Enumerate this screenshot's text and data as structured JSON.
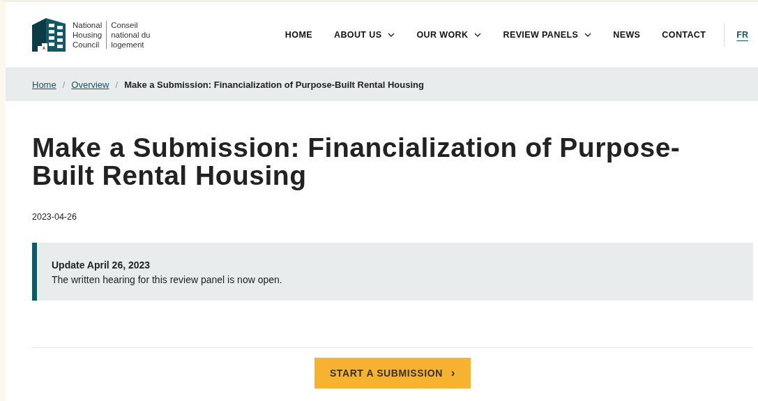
{
  "logo": {
    "english": [
      "National",
      "Housing",
      "Council"
    ],
    "french": [
      "Conseil",
      "national du",
      "logement"
    ]
  },
  "nav": [
    {
      "label": "HOME",
      "dropdown": false
    },
    {
      "label": "ABOUT US",
      "dropdown": true
    },
    {
      "label": "OUR WORK",
      "dropdown": true
    },
    {
      "label": "REVIEW PANELS",
      "dropdown": true
    },
    {
      "label": "NEWS",
      "dropdown": false
    },
    {
      "label": "CONTACT",
      "dropdown": false
    }
  ],
  "language": "FR",
  "breadcrumb": {
    "links": [
      "Home",
      "Overview"
    ],
    "separator": "/",
    "current": "Make a Submission: Financialization of Purpose-Built Rental Housing"
  },
  "title": "Make a Submission: Financialization of Purpose-Built Rental Housing",
  "date": "2023-04-26",
  "callout": {
    "heading": "Update April 26, 2023",
    "text": "The written hearing for this review panel is now open."
  },
  "button": {
    "label": "START A SUBMISSION",
    "arrow": "›"
  }
}
